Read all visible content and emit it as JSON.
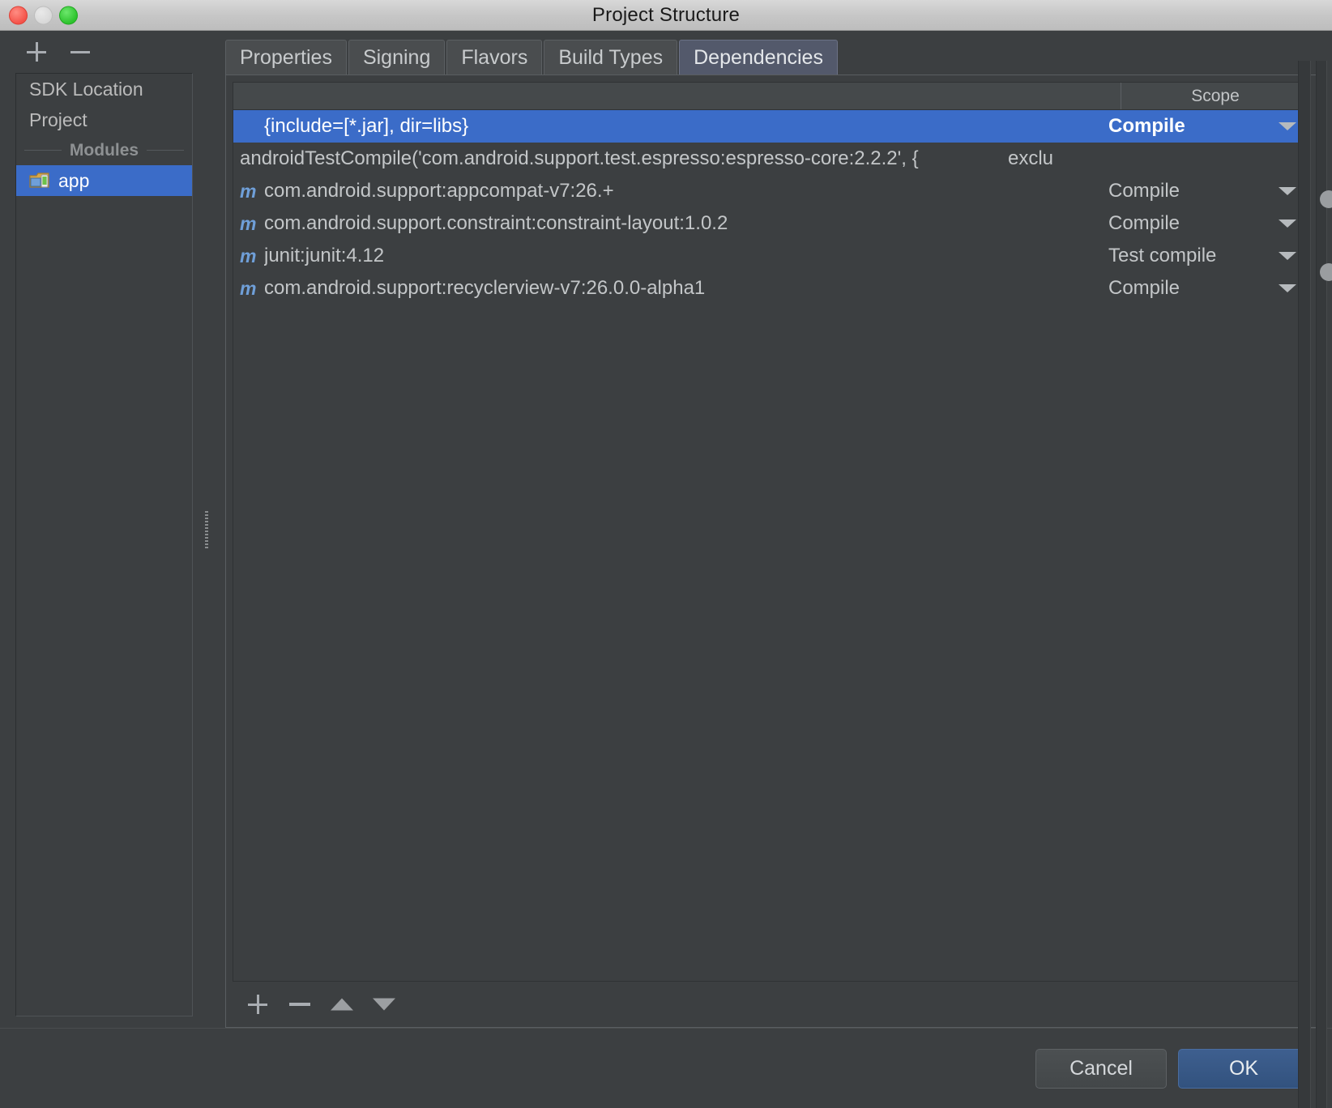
{
  "window": {
    "title": "Project Structure",
    "traffic_lights": [
      "close-button",
      "minimize-button",
      "zoom-button"
    ]
  },
  "left_panel": {
    "toolbar": {
      "add_label": "+",
      "remove_label": "−"
    },
    "tree": {
      "items": [
        {
          "label": "SDK Location",
          "selected": false,
          "icon": ""
        },
        {
          "label": "Project",
          "selected": false,
          "icon": ""
        }
      ],
      "group_label": "Modules",
      "modules": [
        {
          "label": "app",
          "selected": true,
          "icon": "android-module-icon"
        }
      ]
    }
  },
  "right_panel": {
    "tabs": [
      {
        "label": "Properties",
        "active": false
      },
      {
        "label": "Signing",
        "active": false
      },
      {
        "label": "Flavors",
        "active": false
      },
      {
        "label": "Build Types",
        "active": false
      },
      {
        "label": "Dependencies",
        "active": true
      }
    ],
    "table": {
      "headers": {
        "name": "",
        "scope": "Scope"
      },
      "rows": [
        {
          "icon": "",
          "name": "{include=[*.jar], dir=libs}",
          "extra": "",
          "scope": "Compile",
          "has_caret": true,
          "selected": true
        },
        {
          "icon": "",
          "name": "androidTestCompile('com.android.support.test.espresso:espresso-core:2.2.2', {",
          "extra": "exclu",
          "scope": "",
          "has_caret": false,
          "selected": false
        },
        {
          "icon": "m",
          "name": "com.android.support:appcompat-v7:26.+",
          "extra": "",
          "scope": "Compile",
          "has_caret": true,
          "selected": false
        },
        {
          "icon": "m",
          "name": "com.android.support.constraint:constraint-layout:1.0.2",
          "extra": "",
          "scope": "Compile",
          "has_caret": true,
          "selected": false
        },
        {
          "icon": "m",
          "name": "junit:junit:4.12",
          "extra": "",
          "scope": "Test compile",
          "has_caret": true,
          "selected": false
        },
        {
          "icon": "m",
          "name": "com.android.support:recyclerview-v7:26.0.0-alpha1",
          "extra": "",
          "scope": "Compile",
          "has_caret": true,
          "selected": false
        }
      ],
      "toolbar": [
        {
          "icon": "plus-icon",
          "label": "+"
        },
        {
          "icon": "minus-icon",
          "label": "−"
        },
        {
          "icon": "arrow-up-icon",
          "label": "▲"
        },
        {
          "icon": "arrow-down-icon",
          "label": "▼"
        }
      ]
    }
  },
  "footer": {
    "cancel_label": "Cancel",
    "ok_label": "OK"
  },
  "colors": {
    "selection_blue": "#3b6cc8",
    "window_bg": "#3c3f41",
    "tab_active_bg": "#53596b",
    "module_icon_blue": "#6f9fd8",
    "ok_button_blue": "#3e5f8f"
  }
}
